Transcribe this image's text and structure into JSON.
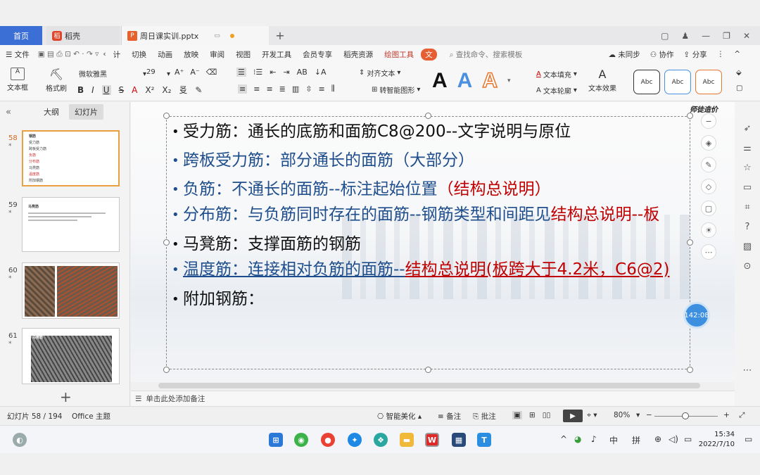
{
  "tabs": {
    "home": "首页",
    "doc": "稻壳",
    "file": "周日课实训.pptx"
  },
  "menu": {
    "file": "文件",
    "items": [
      "计",
      "切换",
      "动画",
      "放映",
      "审阅",
      "视图",
      "开发工具",
      "会员专享",
      "稻壳资源"
    ],
    "draw_tool": "绘图工具",
    "active": "文",
    "search": "查找命令、搜索模板",
    "sync": "未同步",
    "collab": "协作",
    "share": "分享"
  },
  "ribbon": {
    "textbox": "文本框",
    "format_brush": "格式刷",
    "font_name": "微软雅黑",
    "font_size": "29",
    "align_text": "对齐文本",
    "smart_shape": "转智能图形",
    "text_fill": "文本填充",
    "text_outline": "文本轮廓",
    "text_effect": "文本效果",
    "style_a": "A",
    "style_labels": [
      "Abc",
      "Abc",
      "Abc"
    ]
  },
  "left_panel": {
    "outline": "大纲",
    "slides": "幻灯片",
    "thumbs": [
      {
        "num": "58",
        "star": "*",
        "lines": [
          "受力筋",
          "跨板受力筋",
          "负筋",
          "分布筋",
          "马凳筋",
          "温度筋",
          "附加钢筋"
        ]
      },
      {
        "num": "59",
        "star": "*",
        "lines": [
          "马凳筋"
        ]
      },
      {
        "num": "60",
        "star": "*"
      },
      {
        "num": "61",
        "star": "*",
        "lines": [
          "马凳筋"
        ]
      }
    ],
    "add": "+"
  },
  "slide": {
    "logo": "师徒造价",
    "bullets": [
      {
        "text": "受力筋：通长的底筋和面筋C8@200--文字说明与原位",
        "color": "black"
      },
      {
        "text": "跨板受力筋：部分通长的面筋（大部分）",
        "color": "blue"
      },
      {
        "text": "负筋：不通长的面筋--标注起始位置",
        "red": "（结构总说明）",
        "color": "blue"
      },
      {
        "text": "分布筋：与负筋同时存在的面筋--钢筋类型和间距见",
        "red": "结构总说明--板",
        "color": "blue"
      },
      {
        "text": "马凳筋：支撑面筋的钢筋",
        "color": "black"
      },
      {
        "text": "温度筋：连接相对负筋的面筋--",
        "red": "结构总说明(板跨大于4.2米，C6@2)",
        "color": "blue"
      },
      {
        "text": "附加钢筋：",
        "color": "black"
      }
    ],
    "timer": "142:08"
  },
  "notes": "单击此处添加备注",
  "status": {
    "slide_info": "幻灯片 58 / 194",
    "theme": "Office 主题",
    "beautify": "智能美化",
    "notes": "备注",
    "comment": "批注",
    "zoom": "80%"
  },
  "taskbar": {
    "ime_lang": "中",
    "ime_mode": "拼",
    "time": "15:34",
    "date": "2022/7/10"
  }
}
